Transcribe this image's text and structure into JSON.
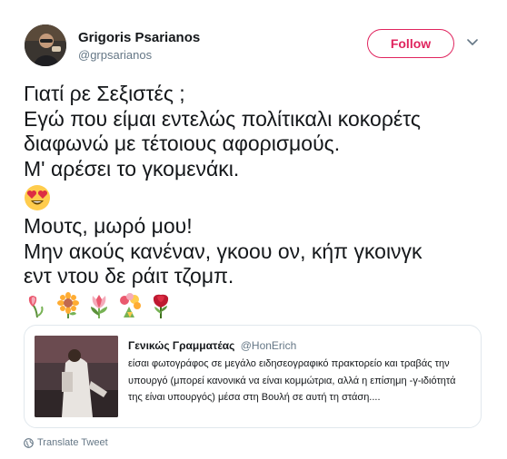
{
  "author": {
    "name": "Grigoris Psarianos",
    "handle": "@grpsarianos",
    "avatar_icon": "profile-photo"
  },
  "follow_button": {
    "label": "Follow",
    "color": "#e0245e"
  },
  "menu_caret_icon": "chevron-down-icon",
  "tweet": {
    "lines": [
      "Γιατί ρε Σεξιστές ;",
      "Εγώ που είμαι εντελώς πολίτικαλι κοκορέτς",
      "διαφωνώ με τέτοιους αφορισμούς.",
      "Μ' αρέσει το γκομενάκι."
    ],
    "emoji_1": "heart-eyes-emoji",
    "lines_2": [
      "Μουτς, μωρό μου!",
      "Μην ακούς κανέναν, γκοου ον, κήπ γκοινγκ",
      "εντ ντου δε ράιτ τζομπ."
    ],
    "emoji_row": [
      "wilted-flower-emoji",
      "sunflower-emoji",
      "tulip-emoji",
      "bouquet-emoji",
      "rose-emoji"
    ]
  },
  "quoted_tweet": {
    "name": "Γενικώς Γραμματέας",
    "handle": "@HonErich",
    "text": "είσαι φωτογράφος σε μεγάλο ειδησεογραφικό πρακτορείο και τραβάς την υπουργό (μπορεί κανονικά να είναι κομμώτρια, αλλά η επίσημη -γ-ιδιότητά της είναι υπουργός) μέσα στη Βουλή σε αυτή τη στάση....",
    "thumbnail_icon": "photo-thumbnail"
  },
  "translate": {
    "label": "Translate Tweet",
    "icon": "globe-icon"
  }
}
